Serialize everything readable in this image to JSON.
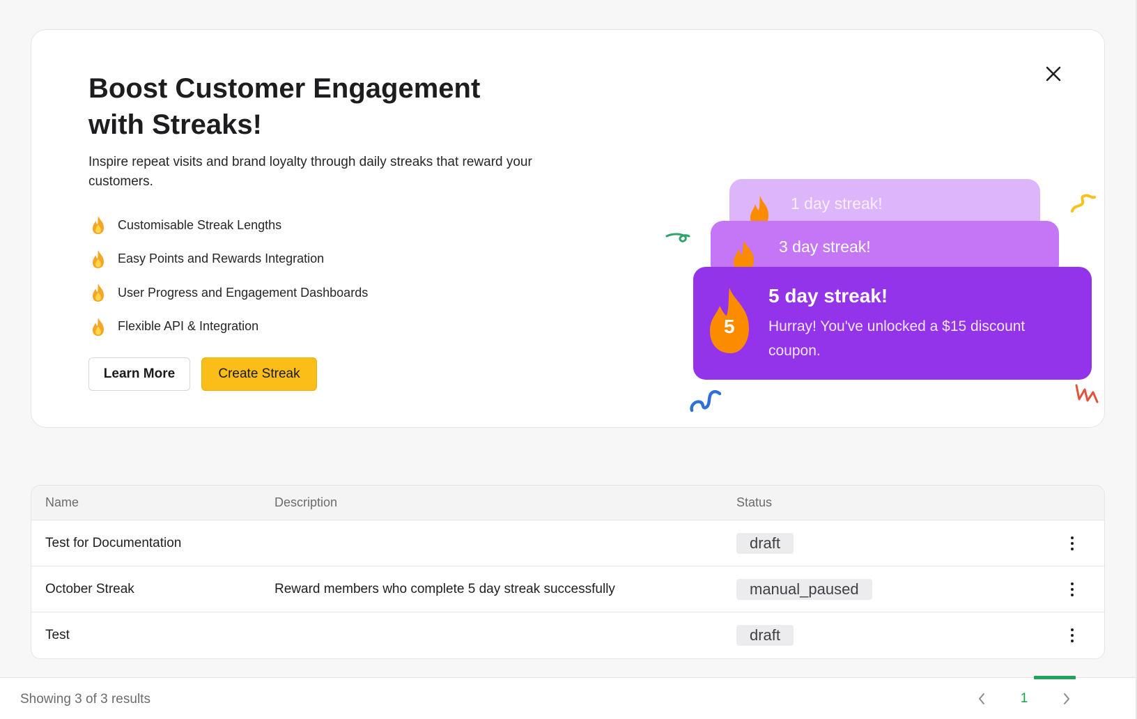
{
  "promo": {
    "title": "Boost Customer Engagement with Streaks!",
    "description": "Inspire repeat visits and brand loyalty through daily streaks that reward your customers.",
    "features": [
      "Customisable Streak Lengths",
      "Easy Points and Rewards Integration",
      "User Progress and Engagement Dashboards",
      "Flexible API & Integration"
    ],
    "learn_more_label": "Learn More",
    "create_streak_label": "Create Streak",
    "illustration": {
      "card1_label": "1 day streak!",
      "card2_label": "3 day streak!",
      "card3_title": "5 day streak!",
      "card3_body": "Hurray! You've unlocked a $15 discount coupon.",
      "card3_number": "5"
    }
  },
  "table": {
    "headers": {
      "name": "Name",
      "description": "Description",
      "status": "Status"
    },
    "rows": [
      {
        "name": "Test for Documentation",
        "description": "",
        "status": "draft"
      },
      {
        "name": "October Streak",
        "description": "Reward members who complete 5 day streak successfully",
        "status": "manual_paused"
      },
      {
        "name": "Test",
        "description": "",
        "status": "draft"
      }
    ]
  },
  "footer": {
    "results_text": "Showing 3 of 3 results",
    "current_page": "1"
  },
  "colors": {
    "accent_yellow": "#fbbd17",
    "purple_dark": "#9333ea",
    "purple_mid": "#c576f7",
    "purple_light": "#ddb5fb",
    "flame_orange": "#fb8c00",
    "pagination_green": "#16a34a"
  },
  "icons": [
    "close-icon",
    "flame-icon",
    "kebab-menu-icon",
    "chevron-left-icon",
    "chevron-right-icon"
  ]
}
